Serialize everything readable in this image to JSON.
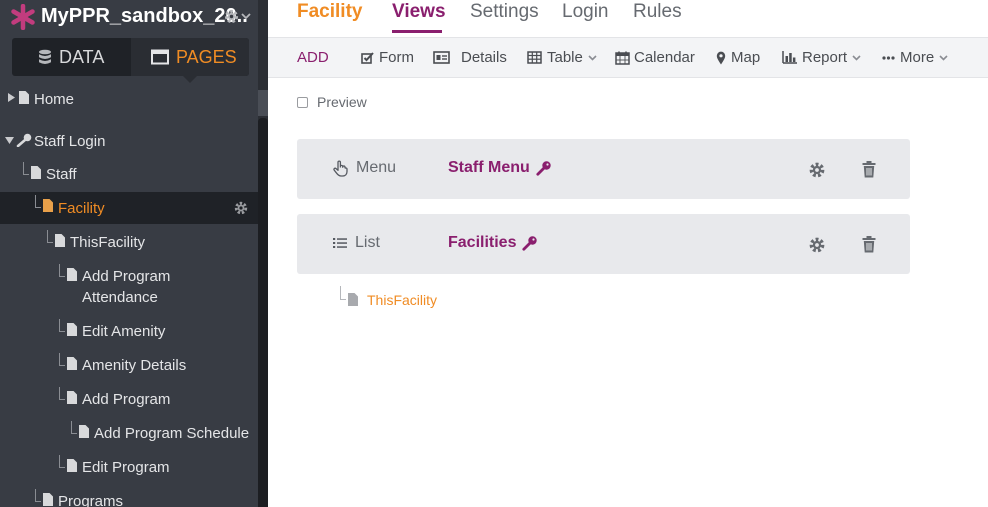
{
  "app": {
    "title": "MyPPR_sandbox_20..",
    "accent_color": "#f08c24",
    "brand_color": "#8a1f6e"
  },
  "mode_toggle": {
    "data_label": "DATA",
    "pages_label": "PAGES",
    "selected": "PAGES"
  },
  "sidebar": {
    "items": [
      {
        "label": "Home",
        "icon": "page-icon",
        "expander": "collapsed"
      },
      {
        "label": "Staff Login",
        "icon": "key-icon",
        "expander": "expanded"
      },
      {
        "label": "Staff",
        "icon": "page-icon"
      },
      {
        "label": "Facility",
        "icon": "page-icon",
        "selected": true
      },
      {
        "label": "ThisFacility",
        "icon": "page-icon"
      },
      {
        "label": "Add Program",
        "label_line2": "Attendance",
        "icon": "page-icon"
      },
      {
        "label": "Edit Amenity",
        "icon": "page-icon"
      },
      {
        "label": "Amenity Details",
        "icon": "page-icon"
      },
      {
        "label": "Add Program",
        "icon": "page-icon"
      },
      {
        "label": "Add Program Schedule",
        "icon": "page-icon"
      },
      {
        "label": "Edit Program",
        "icon": "page-icon"
      },
      {
        "label": "Programs",
        "icon": "page-icon"
      }
    ]
  },
  "topnav": {
    "page_name": "Facility",
    "tabs": [
      "Views",
      "Settings",
      "Login",
      "Rules"
    ],
    "active_tab": "Views"
  },
  "toolbar": {
    "add_label": "ADD",
    "items": [
      {
        "label": "Form",
        "icon": "form-icon"
      },
      {
        "label": "Details",
        "icon": "details-icon"
      },
      {
        "label": "Table",
        "icon": "table-icon",
        "dropdown": true
      },
      {
        "label": "Calendar",
        "icon": "calendar-icon"
      },
      {
        "label": "Map",
        "icon": "map-marker-icon"
      },
      {
        "label": "Report",
        "icon": "bar-chart-icon",
        "dropdown": true
      },
      {
        "label": "More",
        "icon": "ellipsis-icon",
        "dropdown": true
      }
    ]
  },
  "preview": {
    "label": "Preview",
    "checked": false
  },
  "views": [
    {
      "type_label": "Menu",
      "type_icon": "pointer-hand-icon",
      "name": "Staff Menu",
      "secured": true
    },
    {
      "type_label": "List",
      "type_icon": "list-icon",
      "name": "Facilities",
      "secured": true
    }
  ],
  "child_pages": [
    {
      "label": "ThisFacility"
    }
  ]
}
